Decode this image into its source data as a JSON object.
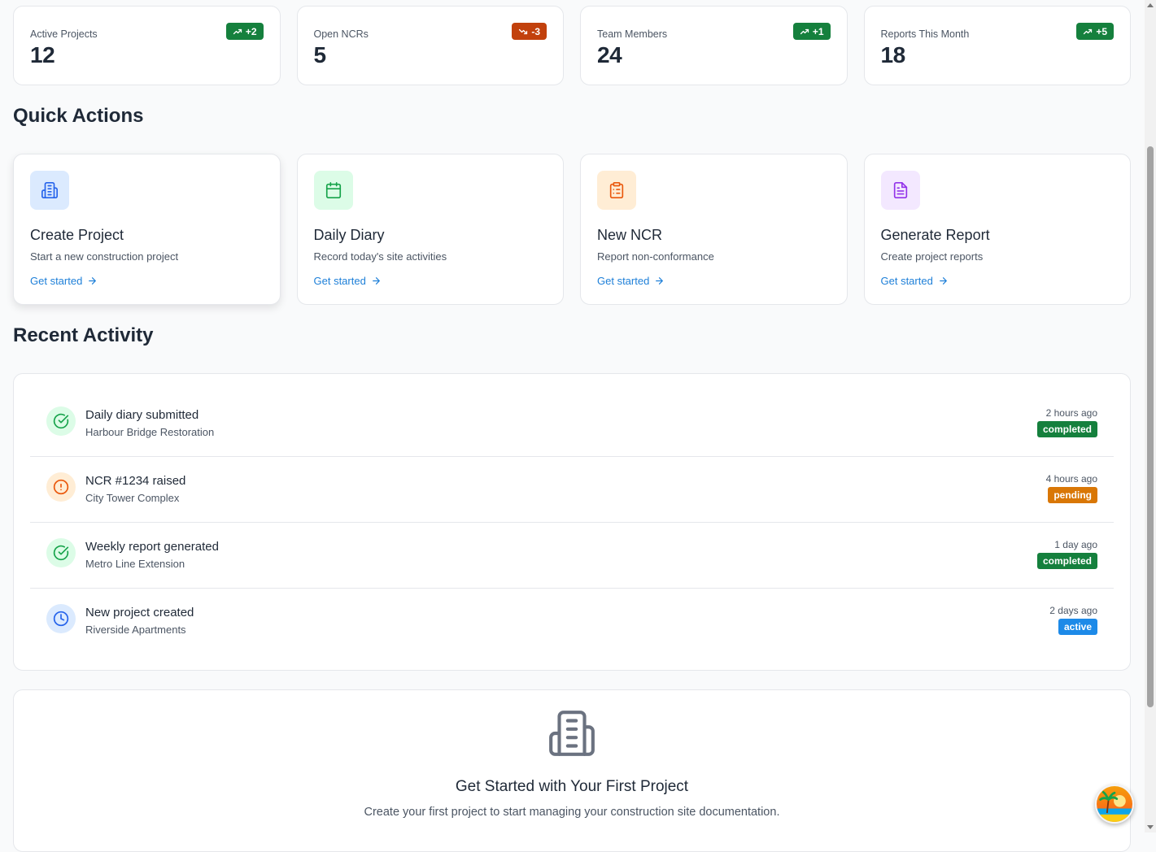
{
  "stats": [
    {
      "label": "Active Projects",
      "value": "12",
      "change": "+2",
      "trend": "up",
      "badge_color": "#15803d"
    },
    {
      "label": "Open NCRs",
      "value": "5",
      "change": "-3",
      "trend": "down",
      "badge_color": "#c2410c"
    },
    {
      "label": "Team Members",
      "value": "24",
      "change": "+1",
      "trend": "up",
      "badge_color": "#15803d"
    },
    {
      "label": "Reports This Month",
      "value": "18",
      "change": "+5",
      "trend": "up",
      "badge_color": "#15803d"
    }
  ],
  "quick_actions": {
    "title": "Quick Actions",
    "items": [
      {
        "title": "Create Project",
        "description": "Start a new construction project",
        "link": "Get started",
        "icon": "building-icon"
      },
      {
        "title": "Daily Diary",
        "description": "Record today's site activities",
        "link": "Get started",
        "icon": "calendar-icon"
      },
      {
        "title": "New NCR",
        "description": "Report non-conformance",
        "link": "Get started",
        "icon": "clipboard-icon"
      },
      {
        "title": "Generate Report",
        "description": "Create project reports",
        "link": "Get started",
        "icon": "document-icon"
      }
    ]
  },
  "recent_activity": {
    "title": "Recent Activity",
    "items": [
      {
        "title": "Daily diary submitted",
        "project": "Harbour Bridge Restoration",
        "time": "2 hours ago",
        "status": "completed",
        "icon": "check-circle-icon"
      },
      {
        "title": "NCR #1234 raised",
        "project": "City Tower Complex",
        "time": "4 hours ago",
        "status": "pending",
        "icon": "alert-circle-icon"
      },
      {
        "title": "Weekly report generated",
        "project": "Metro Line Extension",
        "time": "1 day ago",
        "status": "completed",
        "icon": "check-circle-icon"
      },
      {
        "title": "New project created",
        "project": "Riverside Apartments",
        "time": "2 days ago",
        "status": "active",
        "icon": "clock-icon"
      }
    ]
  },
  "empty_state": {
    "title": "Get Started with Your First Project",
    "description": "Create your first project to start managing your construction site documentation.",
    "icon": "building-icon"
  },
  "colors": {
    "up": "#15803d",
    "down": "#c2410c",
    "completed": "#15803d",
    "pending": "#d97706",
    "active": "#1d8ae8",
    "link": "#1d7fd8"
  }
}
